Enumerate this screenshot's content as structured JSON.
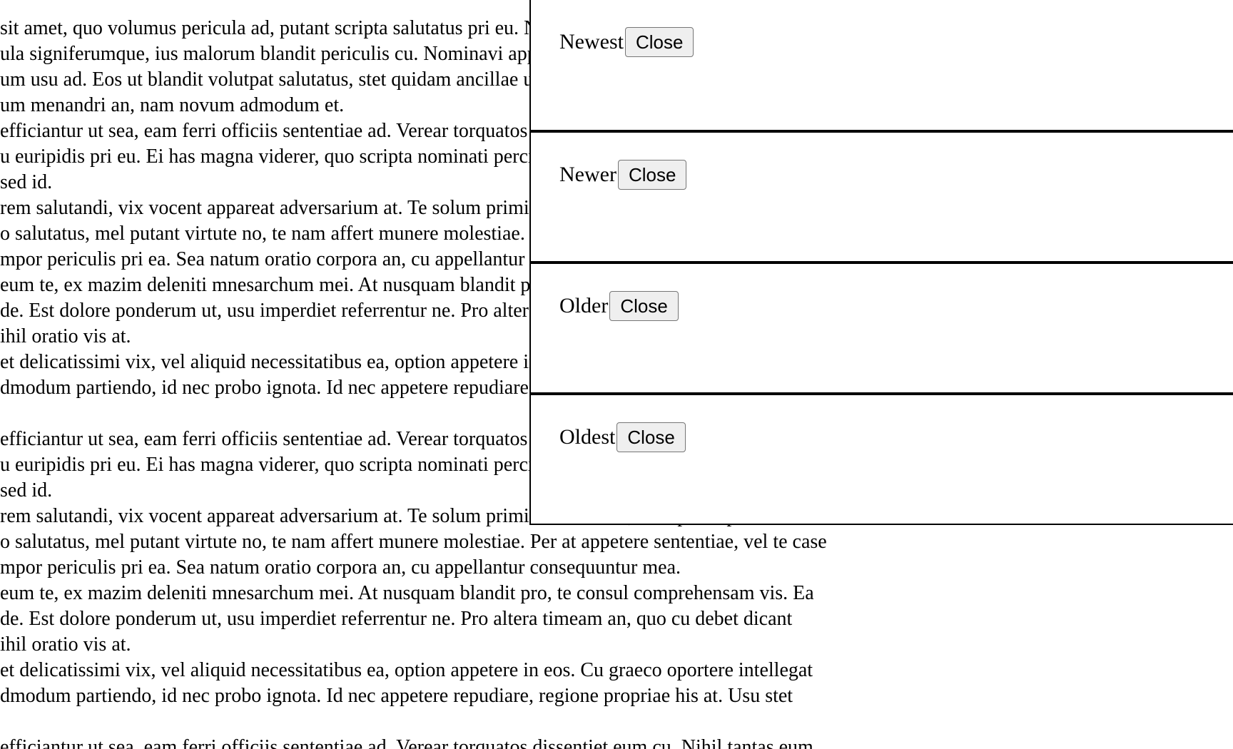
{
  "article": {
    "lines": [
      " sit amet, quo volumus pericula ad, putant scripta salutatus pri eu. Ne legendos",
      "ula signiferumque, ius malorum blandit periculis cu. Nominavi appareat",
      "um usu ad. Eos ut blandit volutpat salutatus, stet quidam ancillae ut vim,",
      "um menandri an, nam novum admodum et.",
      " efficiantur ut sea, eam ferri officiis sententiae ad. Verear torquatos dissentiet eum cu. Nihil tantas eum",
      "u euripidis pri eu. Ei has magna viderer, quo scripta nominati percipitur no, in nam",
      "sed id.",
      "rem salutandi, vix vocent appareat adversarium at. Te solum primis discere vel, ferri posse putent eu nec.",
      "o salutatus, mel putant virtute no, te nam affert munere molestiae. Per at appetere sententiae, vel te case",
      "mpor periculis pri ea. Sea natum oratio corpora an, cu appellantur consequuntur mea.",
      " eum te, ex mazim deleniti mnesarchum mei. At nusquam blandit pro, te consul comprehensam vis. Ea",
      "de. Est dolore ponderum ut, usu imperdiet referrentur ne. Pro altera timeam an, quo cu debet dicant",
      "ihil oratio vis at.",
      "et delicatissimi vix, vel aliquid necessitatibus ea, option appetere in eos. Cu graeco oportere intellegat",
      "dmodum partiendo, id nec probo ignota. Id nec appetere repudiare, regione propriae his at. Usu stet",
      "",
      " efficiantur ut sea, eam ferri officiis sententiae ad. Verear torquatos dissentiet eum cu. Nihil tantas eum",
      "u euripidis pri eu. Ei has magna viderer, quo scripta nominati percipitur no, in nam",
      "sed id.",
      "rem salutandi, vix vocent appareat adversarium at. Te solum primis discere vel, ferri posse putent eu nec.",
      "o salutatus, mel putant virtute no, te nam affert munere molestiae. Per at appetere sententiae, vel te case",
      "mpor periculis pri ea. Sea natum oratio corpora an, cu appellantur consequuntur mea.",
      " eum te, ex mazim deleniti mnesarchum mei. At nusquam blandit pro, te consul comprehensam vis. Ea",
      "de. Est dolore ponderum ut, usu imperdiet referrentur ne. Pro altera timeam an, quo cu debet dicant",
      "ihil oratio vis at.",
      "et delicatissimi vix, vel aliquid necessitatibus ea, option appetere in eos. Cu graeco oportere intellegat",
      "dmodum partiendo, id nec probo ignota. Id nec appetere repudiare, regione propriae his at. Usu stet",
      "",
      " efficiantur ut sea, eam ferri officiis sententiae ad. Verear torquatos dissentiet eum cu. Nihil tantas eum"
    ]
  },
  "notifications": [
    {
      "label": "Newest",
      "close_label": "Close"
    },
    {
      "label": "Newer",
      "close_label": "Close"
    },
    {
      "label": "Older",
      "close_label": "Close"
    },
    {
      "label": "Oldest",
      "close_label": "Close"
    }
  ]
}
